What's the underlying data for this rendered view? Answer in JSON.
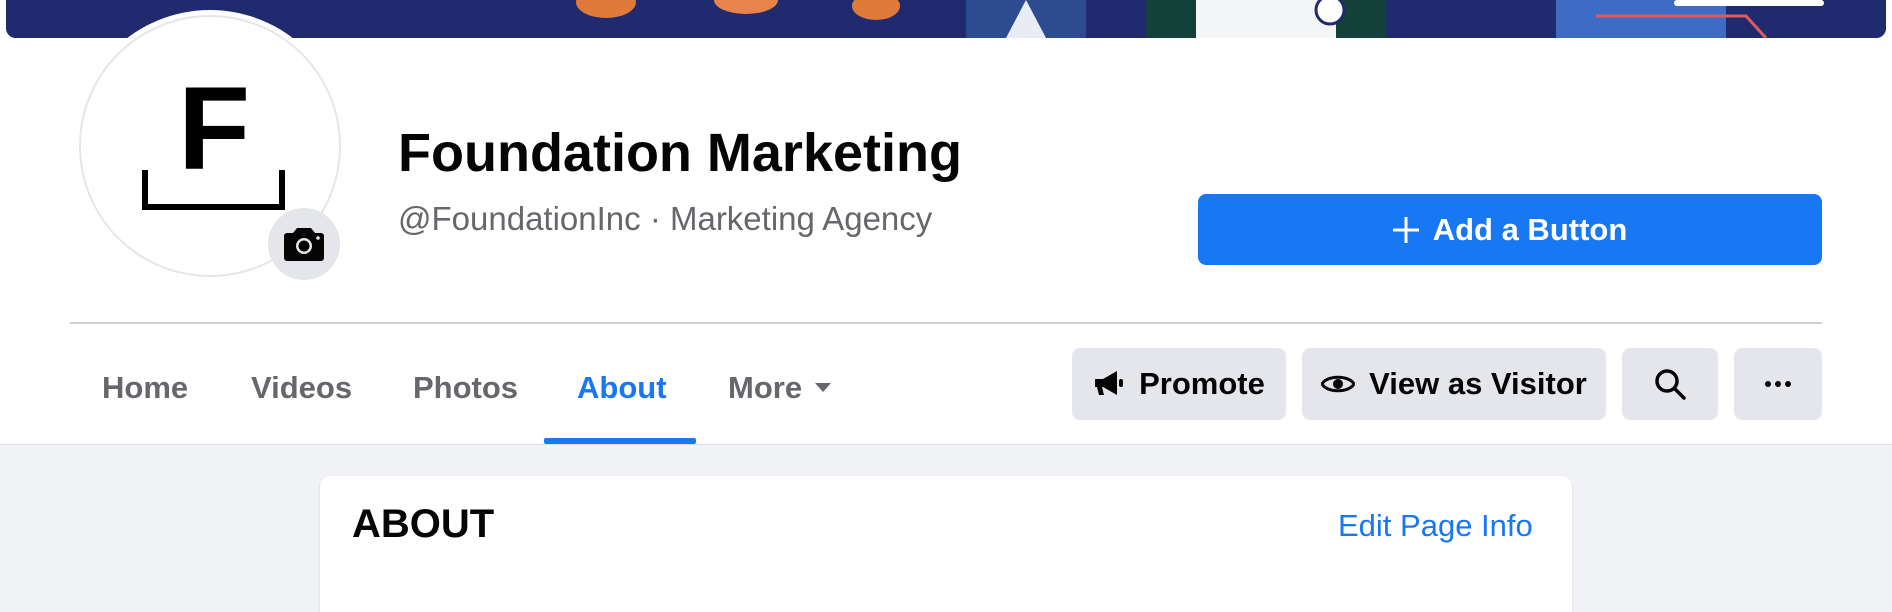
{
  "page": {
    "name": "Foundation Marketing",
    "subtitle": "@FoundationInc · Marketing Agency",
    "logo_letter": "F"
  },
  "cta": {
    "add_button_label": "Add a Button"
  },
  "tabs": [
    {
      "label": "Home"
    },
    {
      "label": "Videos"
    },
    {
      "label": "Photos"
    },
    {
      "label": "About",
      "active": true
    },
    {
      "label": "More"
    }
  ],
  "actions": {
    "promote_label": "Promote",
    "view_as_visitor_label": "View as Visitor",
    "search_icon": "search-icon",
    "more_icon": "ellipsis-icon"
  },
  "about_section": {
    "title": "ABOUT",
    "edit_link": "Edit Page Info"
  },
  "colors": {
    "accent": "#1877f2",
    "secondary_button": "#e4e6eb",
    "muted_text": "#65676b",
    "page_bg": "#f0f2f5"
  }
}
